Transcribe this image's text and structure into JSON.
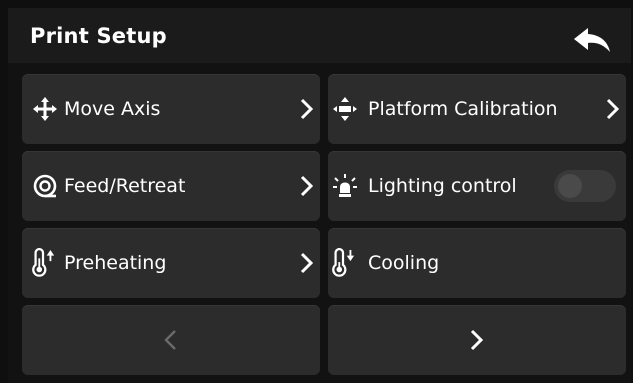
{
  "header": {
    "title": "Print Setup",
    "back_icon": "back-arrow-icon"
  },
  "menu": [
    {
      "label": "Move Axis",
      "icon": "move-axis-icon",
      "control": "chevron"
    },
    {
      "label": "Platform Calibration",
      "icon": "platform-calibration-icon",
      "control": "chevron"
    },
    {
      "label": "Feed/Retreat",
      "icon": "feed-retreat-icon",
      "control": "chevron"
    },
    {
      "label": "Lighting control",
      "icon": "light-icon",
      "control": "toggle",
      "toggle_on": false
    },
    {
      "label": "Preheating",
      "icon": "thermometer-up-icon",
      "control": "chevron"
    },
    {
      "label": "Cooling",
      "icon": "thermometer-down-icon",
      "control": "none"
    }
  ],
  "pagination": {
    "prev_enabled": false,
    "next_enabled": true
  },
  "colors": {
    "background": "#121212",
    "tile": "#2c2c2c",
    "text": "#ffffff",
    "disabled": "#6a6a6a"
  }
}
